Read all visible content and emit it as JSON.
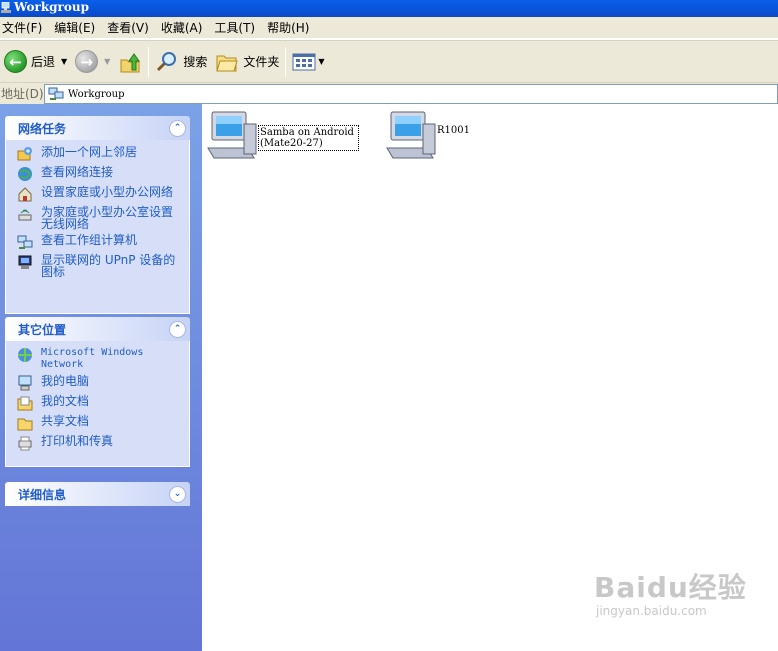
{
  "window": {
    "title": "Workgroup"
  },
  "menu": {
    "items": [
      "文件(F)",
      "编辑(E)",
      "查看(V)",
      "收藏(A)",
      "工具(T)",
      "帮助(H)"
    ]
  },
  "toolbar": {
    "back_label": "后退",
    "search_label": "搜索",
    "folders_label": "文件夹"
  },
  "address": {
    "label": "地址(D)",
    "value": "Workgroup"
  },
  "tasks": {
    "network": {
      "title": "网络任务",
      "items": [
        {
          "label": "添加一个网上邻居",
          "icon": "add-network-place-icon"
        },
        {
          "label": "查看网络连接",
          "icon": "network-connections-icon"
        },
        {
          "label": "设置家庭或小型办公网络",
          "icon": "home-network-setup-icon"
        },
        {
          "label": "为家庭或小型办公室设置无线网络",
          "icon": "wireless-setup-icon"
        },
        {
          "label": "查看工作组计算机",
          "icon": "workgroup-computers-icon"
        },
        {
          "label": "显示联网的 UPnP 设备的图标",
          "icon": "upnp-device-icon"
        }
      ]
    },
    "other": {
      "title": "其它位置",
      "items": [
        {
          "label": "Microsoft Windows Network",
          "icon": "windows-network-icon"
        },
        {
          "label": "我的电脑",
          "icon": "my-computer-icon"
        },
        {
          "label": "我的文档",
          "icon": "my-documents-icon"
        },
        {
          "label": "共享文档",
          "icon": "shared-documents-icon"
        },
        {
          "label": "打印机和传真",
          "icon": "printers-faxes-icon"
        }
      ]
    },
    "details": {
      "title": "详细信息"
    }
  },
  "computers": [
    {
      "name": "Samba on Android (Mate20-27)",
      "line1": "Samba on Android",
      "line2": "(Mate20-27)",
      "selected": true
    },
    {
      "name": "R1001",
      "line1": "R1001",
      "line2": "",
      "selected": false
    }
  ],
  "watermark": {
    "brand": "Baidu经验",
    "url": "jingyan.baidu.com"
  },
  "colors": {
    "titlebar": "#0a55dd",
    "task_pane": "#7ba2e7",
    "link": "#215dc6"
  }
}
